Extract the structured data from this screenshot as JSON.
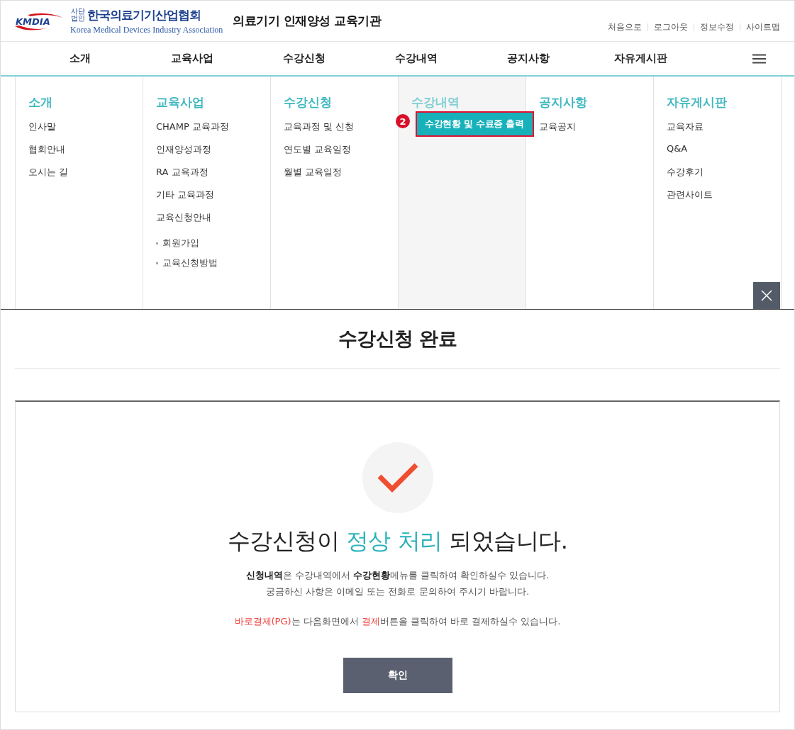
{
  "header": {
    "logo": {
      "mark": "KMDIA",
      "corp_type": "사단법인",
      "name": "한국의료기기산업협회",
      "english": "Korea Medical Devices Industry Association"
    },
    "site_title": "의료기기 인재양성 교육기관",
    "util_links": [
      "처음으로",
      "로그아웃",
      "정보수정",
      "사이트맵"
    ]
  },
  "nav": {
    "items": [
      "소개",
      "교육사업",
      "수강신청",
      "수강내역",
      "공지사항",
      "자유게시판"
    ]
  },
  "mega_menu": {
    "columns": [
      {
        "title": "소개",
        "selected": false,
        "items": [
          {
            "label": "인사말",
            "kind": "link",
            "highlighted": false
          },
          {
            "label": "협회안내",
            "kind": "link",
            "highlighted": false
          },
          {
            "label": "오시는 길",
            "kind": "link",
            "highlighted": false
          }
        ]
      },
      {
        "title": "교육사업",
        "selected": false,
        "items": [
          {
            "label": "CHAMP 교육과정",
            "kind": "link",
            "highlighted": false
          },
          {
            "label": "인재양성과정",
            "kind": "link",
            "highlighted": false
          },
          {
            "label": "RA 교육과정",
            "kind": "link",
            "highlighted": false
          },
          {
            "label": "기타 교육과정",
            "kind": "link",
            "highlighted": false
          },
          {
            "label": "교육신청안내",
            "kind": "link",
            "highlighted": false
          },
          {
            "label": "회원가입",
            "kind": "sub",
            "highlighted": false
          },
          {
            "label": "교육신청방법",
            "kind": "sub",
            "highlighted": false
          }
        ]
      },
      {
        "title": "수강신청",
        "selected": false,
        "items": [
          {
            "label": "교육과정 및 신청",
            "kind": "link",
            "highlighted": false
          },
          {
            "label": "연도별 교육일정",
            "kind": "link",
            "highlighted": false
          },
          {
            "label": "월별 교육일정",
            "kind": "link",
            "highlighted": false
          }
        ]
      },
      {
        "title": "수강내역",
        "selected": true,
        "items": [
          {
            "label": "수강현황 및 수료증 출력",
            "kind": "link",
            "highlighted": true,
            "badge": "2"
          }
        ]
      },
      {
        "title": "공지사항",
        "selected": false,
        "items": [
          {
            "label": "교육공지",
            "kind": "link",
            "highlighted": false
          }
        ]
      },
      {
        "title": "자유게시판",
        "selected": false,
        "items": [
          {
            "label": "교육자료",
            "kind": "link",
            "highlighted": false
          },
          {
            "label": "Q&A",
            "kind": "link",
            "highlighted": false
          },
          {
            "label": "수강후기",
            "kind": "link",
            "highlighted": false
          },
          {
            "label": "관련사이트",
            "kind": "link",
            "highlighted": false
          }
        ]
      }
    ]
  },
  "page_title": "수강신청 완료",
  "result": {
    "headline": [
      {
        "text": "수강신청이 ",
        "kind": "plain"
      },
      {
        "text": "정상 처리",
        "kind": "accent"
      },
      {
        "text": " 되었습니다.",
        "kind": "plain"
      }
    ],
    "paragraphs": [
      [
        {
          "text": "신청내역",
          "kind": "bold"
        },
        {
          "text": "은 수강내역에서 ",
          "kind": "plain"
        },
        {
          "text": "수강현황",
          "kind": "bold"
        },
        {
          "text": "메뉴를 클릭하여 확인하실수 있습니다.",
          "kind": "plain"
        }
      ],
      [
        {
          "text": "궁금하신 사항은 이메일 또는 전화로 문의하여 주시기 바랍니다.",
          "kind": "plain"
        }
      ],
      [
        {
          "text": "바로결제(PG)",
          "kind": "red"
        },
        {
          "text": "는 다음화면에서 ",
          "kind": "plain"
        },
        {
          "text": "결제",
          "kind": "red"
        },
        {
          "text": "버튼을 클릭하여 바로 결제하실수 있습니다.",
          "kind": "plain"
        }
      ]
    ],
    "confirm_button": "확인"
  }
}
